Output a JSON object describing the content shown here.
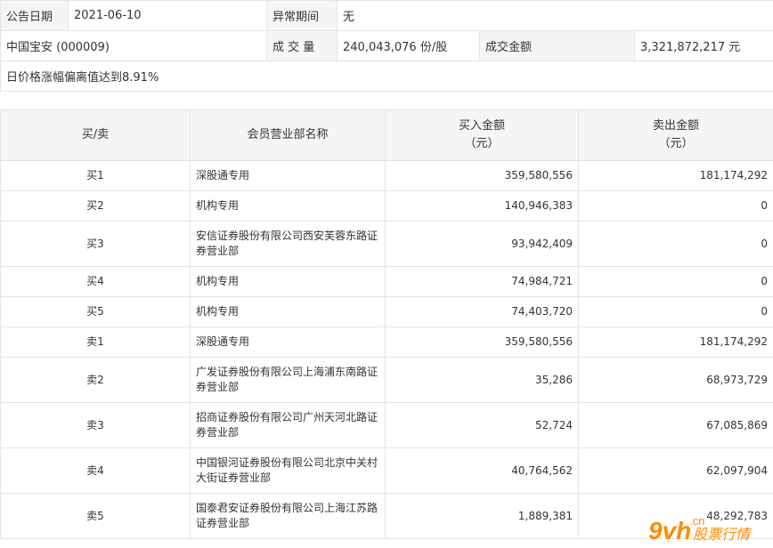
{
  "info": {
    "announce_date_label": "公告日期",
    "announce_date": "2021-06-10",
    "abnormal_period_label": "异常期间",
    "abnormal_period": "无",
    "stock": "中国宝安 (000009)",
    "volume_label": "成 交 量",
    "volume": "240,043,076 份/股",
    "amount_label": "成交金额",
    "amount": "3,321,872,217 元",
    "reason": "日价格涨幅偏离值达到8.91%"
  },
  "table": {
    "headers": [
      "买/卖",
      "会员营业部名称",
      "买入金额\n（元）",
      "卖出金额\n（元）"
    ],
    "rows": [
      {
        "side": "买1",
        "name": "深股通专用",
        "buy": "359,580,556",
        "sell": "181,174,292"
      },
      {
        "side": "买2",
        "name": "机构专用",
        "buy": "140,946,383",
        "sell": "0"
      },
      {
        "side": "买3",
        "name": "安信证券股份有限公司西安芙蓉东路证券营业部",
        "buy": "93,942,409",
        "sell": "0"
      },
      {
        "side": "买4",
        "name": "机构专用",
        "buy": "74,984,721",
        "sell": "0"
      },
      {
        "side": "买5",
        "name": "机构专用",
        "buy": "74,403,720",
        "sell": "0"
      },
      {
        "side": "卖1",
        "name": "深股通专用",
        "buy": "359,580,556",
        "sell": "181,174,292"
      },
      {
        "side": "卖2",
        "name": "广发证券股份有限公司上海浦东南路证券营业部",
        "buy": "35,286",
        "sell": "68,973,729"
      },
      {
        "side": "卖3",
        "name": "招商证券股份有限公司广州天河北路证券营业部",
        "buy": "52,724",
        "sell": "67,085,869"
      },
      {
        "side": "卖4",
        "name": "中国银河证券股份有限公司北京中关村大街证券营业部",
        "buy": "40,764,562",
        "sell": "62,097,904"
      },
      {
        "side": "卖5",
        "name": "国泰君安证券股份有限公司上海江苏路证券营业部",
        "buy": "1,889,381",
        "sell": "48,292,783"
      }
    ]
  },
  "watermark": {
    "text": "9vh",
    "sub": "股票行情",
    "dot": ".cn",
    "color": "#ff8c00"
  }
}
